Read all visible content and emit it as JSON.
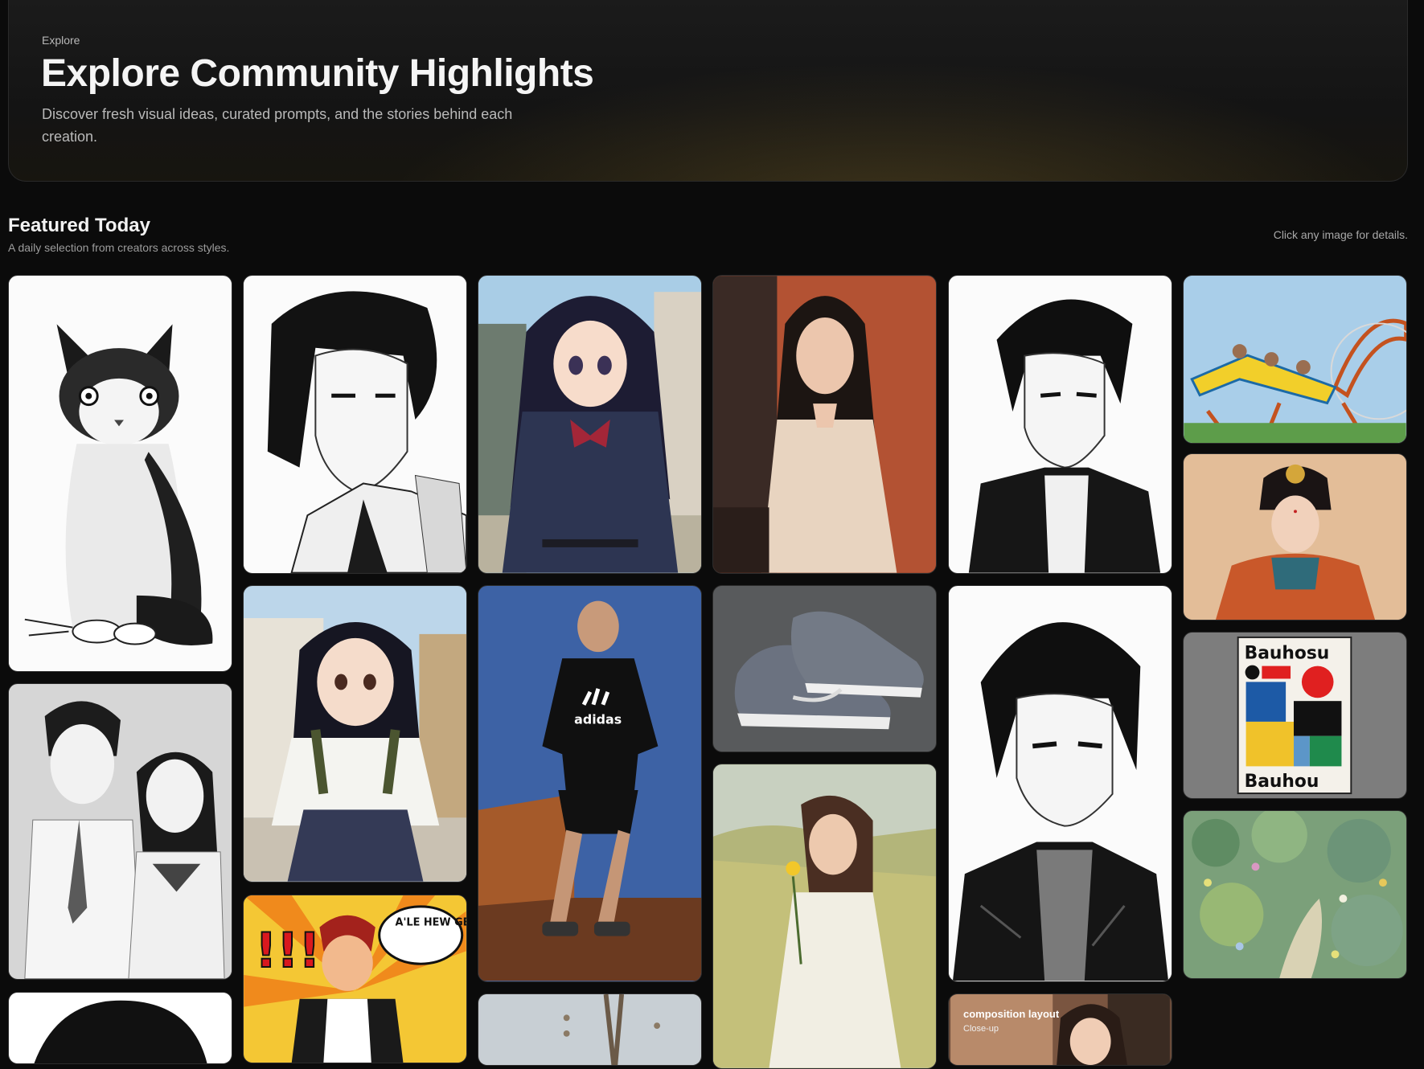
{
  "hero": {
    "eyebrow": "Explore",
    "title": "Explore Community Highlights",
    "description": "Discover fresh visual ideas, curated prompts, and the stories behind each creation."
  },
  "featured": {
    "title": "Featured Today",
    "subtitle": "A daily selection from creators across styles.",
    "hint": "Click any image for details."
  },
  "gallery": {
    "items": [
      {
        "subject": "sketch-cat"
      },
      {
        "subject": "manga-couple"
      },
      {
        "subject": "manga-boy-partial"
      },
      {
        "subject": "manga-boy-long-hair"
      },
      {
        "subject": "anime-schoolgirl-white"
      },
      {
        "subject": "comic-hero",
        "caption": "A'LE HEW GEED LOGCT!"
      },
      {
        "subject": "anime-schoolgirl-navy"
      },
      {
        "subject": "adidas-man",
        "brand_text": "adidas"
      },
      {
        "subject": "jewelry-partial"
      },
      {
        "subject": "woman-silk-dress"
      },
      {
        "subject": "grey-sneakers"
      },
      {
        "subject": "oil-painting-woman"
      },
      {
        "subject": "manga-boy-jacket"
      },
      {
        "subject": "manga-boy-jacket-2"
      },
      {
        "subject": "composition-layout",
        "overlay_title": "composition layout",
        "overlay_sub": "Close-up"
      },
      {
        "subject": "roller-coaster"
      },
      {
        "subject": "traditional-costume"
      },
      {
        "subject": "bauhaus-poster",
        "poster_top": "Bauhosu",
        "poster_bottom": "Bauhou"
      },
      {
        "subject": "impressionist-garden"
      }
    ]
  },
  "colors": {
    "background": "#0b0b0b",
    "bauhaus_red": "#e02020",
    "bauhaus_blue": "#1d5aa6",
    "bauhaus_yellow": "#f0c22a",
    "bauhaus_green": "#1f8a4c"
  }
}
